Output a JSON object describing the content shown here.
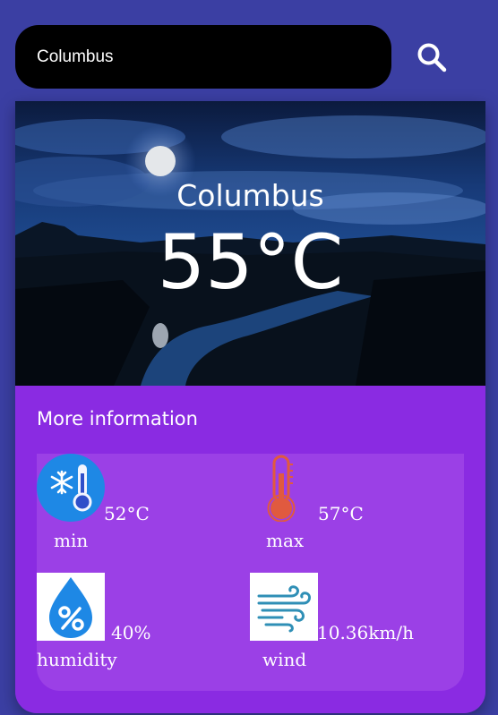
{
  "search": {
    "value": "Columbus",
    "placeholder": ""
  },
  "weather": {
    "city": "Columbus",
    "temperature": "55°C"
  },
  "info": {
    "title": "More information",
    "min": {
      "value": "52°C",
      "label": "min",
      "icon": "snowflake-thermometer-icon"
    },
    "max": {
      "value": "57°C",
      "label": "max",
      "icon": "thermometer-icon"
    },
    "humidity": {
      "value": "40%",
      "label": "humidity",
      "icon": "humidity-drop-icon"
    },
    "wind": {
      "value": "10.36km/h",
      "label": "wind",
      "icon": "wind-icon"
    }
  },
  "colors": {
    "page_background": "#3b3fa3",
    "search_background": "#000000",
    "info_background": "#8a2be2",
    "panel_background": "#9b40e6",
    "text": "#ffffff"
  }
}
